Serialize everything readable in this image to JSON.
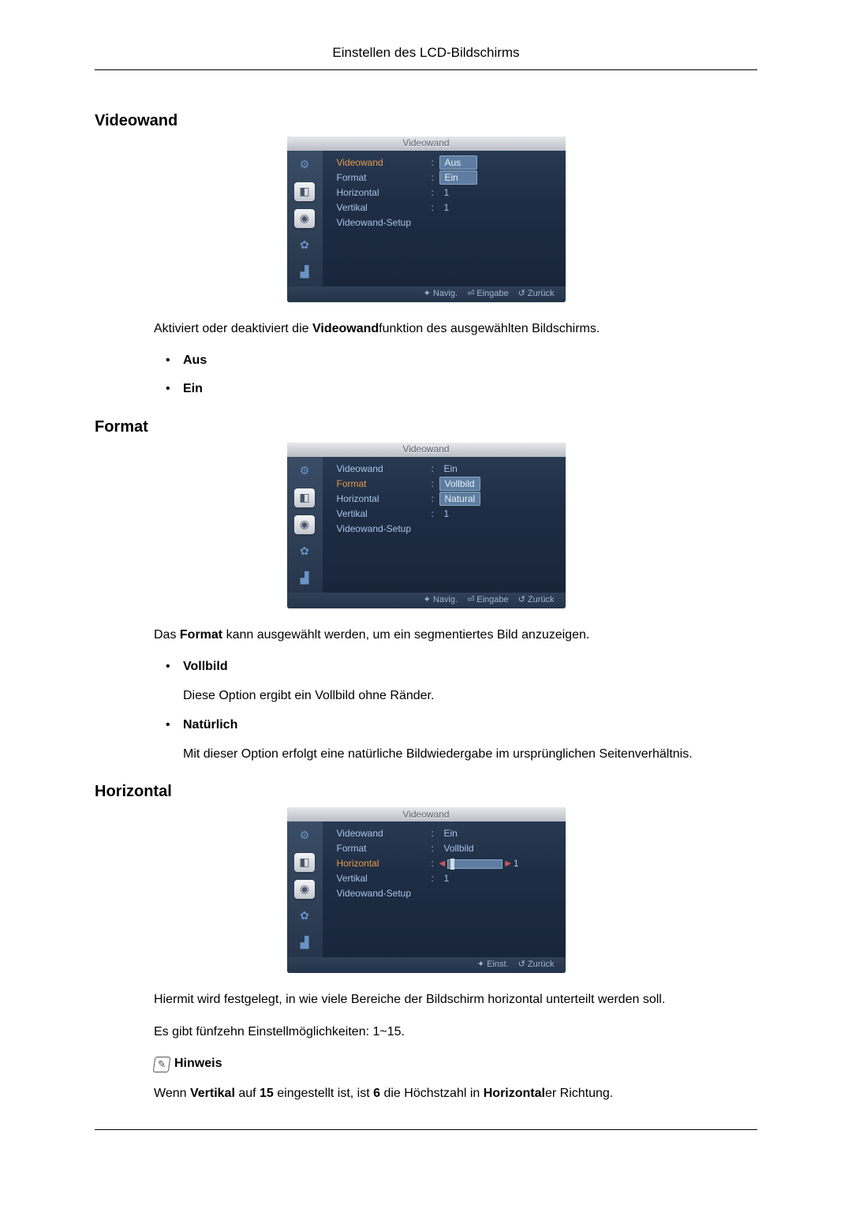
{
  "page_header": "Einstellen des LCD-Bildschirms",
  "sections": {
    "videowand": {
      "title": "Videowand",
      "menu": {
        "title": "Videowand",
        "rows": [
          {
            "label": "Videowand",
            "value": "Aus",
            "highlight": true,
            "selected": true
          },
          {
            "label": "Format",
            "value": "Ein",
            "box": true
          },
          {
            "label": "Horizontal",
            "value": "1"
          },
          {
            "label": "Vertikal",
            "value": "1"
          },
          {
            "label": "Videowand-Setup",
            "value": ""
          }
        ],
        "footer": {
          "nav": "Navig.",
          "enter": "Eingabe",
          "back": "Zurück",
          "nav_icon": "✦",
          "enter_icon": "⏎",
          "back_icon": "↺"
        }
      },
      "description_pre": "Aktiviert oder deaktiviert die ",
      "description_bold": "Videowand",
      "description_post": "funktion des ausgewählten Bildschirms.",
      "bullets": [
        {
          "title": "Aus"
        },
        {
          "title": "Ein"
        }
      ]
    },
    "format": {
      "title": "Format",
      "menu": {
        "title": "Videowand",
        "rows": [
          {
            "label": "Videowand",
            "value": "Ein"
          },
          {
            "label": "Format",
            "value": "Vollbild",
            "highlight": true,
            "selected": true
          },
          {
            "label": "Horizontal",
            "value": "Natural",
            "box": true
          },
          {
            "label": "Vertikal",
            "value": "1"
          },
          {
            "label": "Videowand-Setup",
            "value": ""
          }
        ],
        "footer": {
          "nav": "Navig.",
          "enter": "Eingabe",
          "back": "Zurück",
          "nav_icon": "✦",
          "enter_icon": "⏎",
          "back_icon": "↺"
        }
      },
      "description_pre": "Das ",
      "description_bold": "Format",
      "description_post": " kann ausgewählt werden, um ein segmentiertes Bild anzuzeigen.",
      "bullets": [
        {
          "title": "Vollbild",
          "text": "Diese Option ergibt ein Vollbild ohne Ränder."
        },
        {
          "title": "Natürlich",
          "text": "Mit dieser Option erfolgt eine natürliche Bildwiedergabe im ursprünglichen Seitenverhältnis."
        }
      ]
    },
    "horizontal": {
      "title": "Horizontal",
      "menu": {
        "title": "Videowand",
        "rows": [
          {
            "label": "Videowand",
            "value": "Ein"
          },
          {
            "label": "Format",
            "value": "Vollbild"
          },
          {
            "label": "Horizontal",
            "value_slider": "1",
            "highlight": true
          },
          {
            "label": "Vertikal",
            "value": "1"
          },
          {
            "label": "Videowand-Setup",
            "value": ""
          }
        ],
        "footer": {
          "nav": "Einst.",
          "back": "Zurück",
          "nav_icon": "✦",
          "back_icon": "↺"
        }
      },
      "desc1": "Hiermit wird festgelegt, in wie viele Bereiche der Bildschirm horizontal unterteilt werden soll.",
      "desc2": "Es gibt fünfzehn Einstellmöglichkeiten: 1~15.",
      "note_label": "Hinweis",
      "note_pre": "Wenn ",
      "note_b1": "Vertikal",
      "note_mid1": " auf ",
      "note_b2": "15",
      "note_mid2": " eingestellt ist, ist ",
      "note_b3": "6",
      "note_mid3": " die Höchstzahl in ",
      "note_b4": "Horizontal",
      "note_post": "er Richtung."
    }
  },
  "icons": {
    "i1": "⚙",
    "i2": "◧",
    "i3": "◉",
    "i4": "✿",
    "i5": "▟"
  }
}
